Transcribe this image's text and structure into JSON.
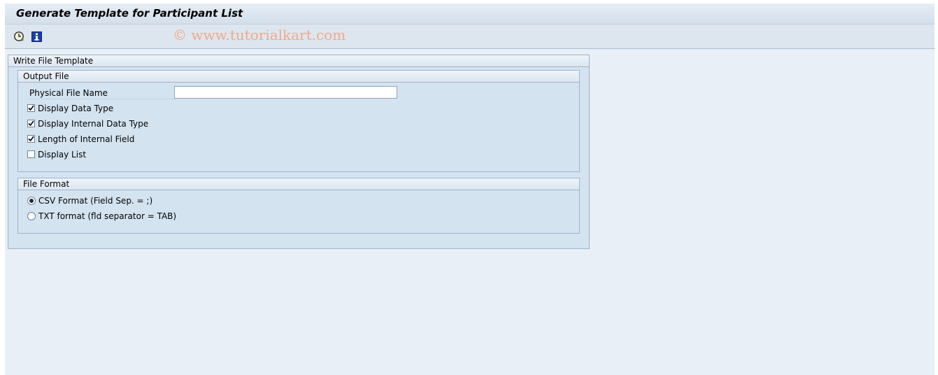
{
  "window": {
    "title": "Generate Template for Participant List"
  },
  "toolbar": {
    "execute_icon": "execute-clock-icon",
    "info_icon": "information-icon",
    "watermark": "© www.tutorialkart.com"
  },
  "main": {
    "group_title": "Write File Template",
    "output_file": {
      "title": "Output File",
      "physical_file_label": "Physical File Name",
      "physical_file_value": "",
      "checkboxes": [
        {
          "label": "Display Data Type",
          "checked": true
        },
        {
          "label": "Display Internal Data Type",
          "checked": true
        },
        {
          "label": "Length of Internal Field",
          "checked": true
        },
        {
          "label": "Display List",
          "checked": false
        }
      ]
    },
    "file_format": {
      "title": "File Format",
      "options": [
        {
          "label": "CSV Format (Field Sep. = ;)",
          "selected": true
        },
        {
          "label": "TXT format (fld separator = TAB)",
          "selected": false
        }
      ]
    }
  },
  "colors": {
    "background": "#e9eff6",
    "group_fill": "#d4e3f0",
    "watermark": "#f0a98a"
  }
}
